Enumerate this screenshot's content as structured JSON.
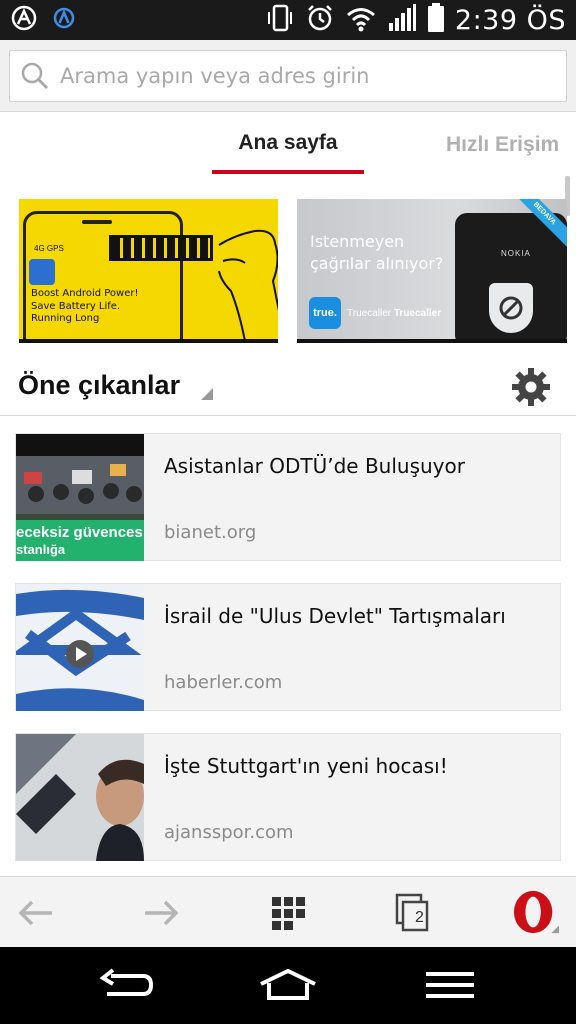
{
  "status_bar": {
    "time": "2:39 ÖS",
    "icons": [
      "app-a-icon",
      "app-a2-icon",
      "vibrate-icon",
      "alarm-icon",
      "wifi-icon",
      "signal-icon",
      "battery-icon"
    ]
  },
  "search": {
    "placeholder": "Arama yapın veya adres girin"
  },
  "tabs": [
    {
      "label": "Ana sayfa",
      "active": true
    },
    {
      "label": "Hızlı Erişim",
      "active": false
    }
  ],
  "ads": [
    {
      "lines": [
        "Boost Android Power!",
        "Save Battery Life.",
        "Running Long"
      ],
      "phone_status": "4G   GPS"
    },
    {
      "lines": [
        "Istenmeyen",
        "çağrılar alınıyor?"
      ],
      "badge": "BEDAVA",
      "logo": "true.",
      "brand_plain": "Truecaller ",
      "brand_bold": "Truecaller",
      "phone_brand": "NOKIA"
    }
  ],
  "section": {
    "title": "Öne çıkanlar"
  },
  "news": [
    {
      "title": "Asistanlar ODTÜ’de Buluşuyor",
      "source": "bianet.org",
      "thumb_text": [
        "eceksiz güvences",
        "stanlığa"
      ]
    },
    {
      "title": "İsrail de \"Ulus Devlet\" Tartışmaları",
      "source": "haberler.com"
    },
    {
      "title": "İşte Stuttgart'ın yeni hocası!",
      "source": "ajansspor.com"
    }
  ],
  "toolbar": {
    "tabs_count": "2"
  },
  "colors": {
    "accent": "#d0021b",
    "status_bar": "#1a1a1a",
    "ad_yellow": "#f5d800",
    "opera_red": "#cc0f16"
  }
}
